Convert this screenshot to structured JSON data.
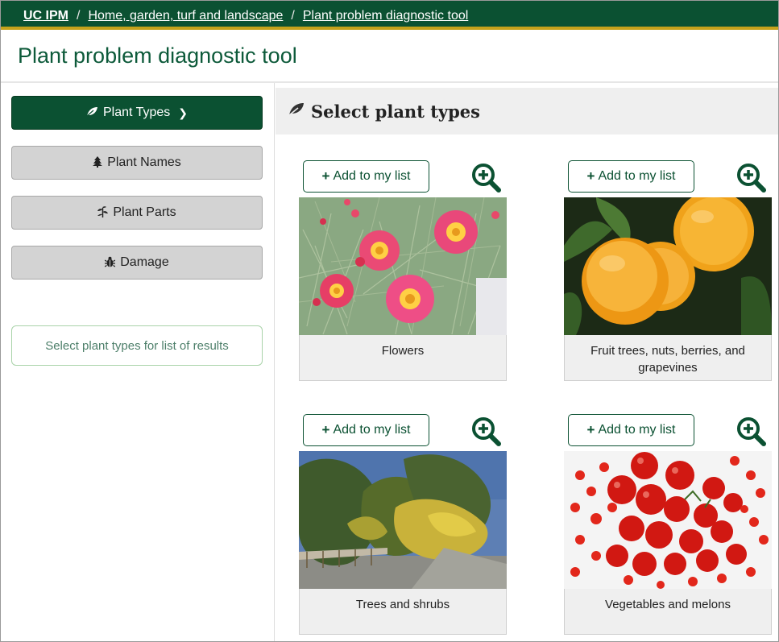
{
  "breadcrumb": {
    "root": "UC IPM",
    "items": [
      "Home, garden, turf and landscape",
      "Plant problem diagnostic tool"
    ],
    "separator": "/"
  },
  "page_title": "Plant problem diagnostic tool",
  "sidebar": {
    "buttons": [
      {
        "label": "Plant Types",
        "icon": "leaf-icon",
        "active": true
      },
      {
        "label": "Plant Names",
        "icon": "tree-icon",
        "active": false
      },
      {
        "label": "Plant Parts",
        "icon": "plant-icon",
        "active": false
      },
      {
        "label": "Damage",
        "icon": "bug-icon",
        "active": false
      }
    ],
    "results_hint": "Select plant types for list of results"
  },
  "main": {
    "heading": "Select plant types",
    "add_label": "Add to my list",
    "cards": [
      {
        "caption": "Flowers",
        "image": "pink-daisy-flowers-photo"
      },
      {
        "caption": "Fruit trees, nuts, berries, and grapevines",
        "image": "oranges-photo"
      },
      {
        "caption": "Trees and shrubs",
        "image": "trees-shrubs-photo"
      },
      {
        "caption": "Vegetables and melons",
        "image": "tomatoes-photo"
      }
    ]
  },
  "colors": {
    "brand_green": "#0b5132",
    "gold_accent": "#c5a21b",
    "title_green": "#0d5a3a"
  }
}
